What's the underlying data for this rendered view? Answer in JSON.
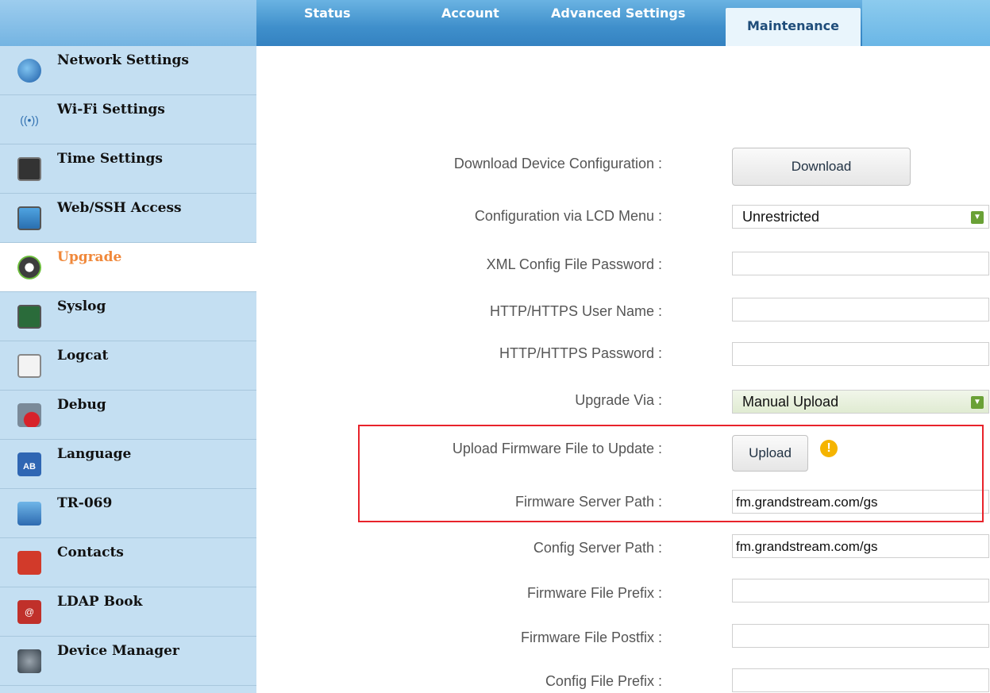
{
  "tabs": [
    {
      "label": "Status"
    },
    {
      "label": "Account"
    },
    {
      "label": "Advanced Settings"
    },
    {
      "label": "Maintenance"
    }
  ],
  "sidebar": {
    "items": [
      {
        "label": "Network Settings",
        "icon": "network-globe-icon"
      },
      {
        "label": "Wi-Fi Settings",
        "icon": "wifi-icon"
      },
      {
        "label": "Time Settings",
        "icon": "clock-icon"
      },
      {
        "label": "Web/SSH Access",
        "icon": "monitor-icon"
      },
      {
        "label": "Upgrade",
        "icon": "upgrade-icon"
      },
      {
        "label": "Syslog",
        "icon": "syslog-icon"
      },
      {
        "label": "Logcat",
        "icon": "magnifier-icon"
      },
      {
        "label": "Debug",
        "icon": "bug-icon"
      },
      {
        "label": "Language",
        "icon": "language-icon"
      },
      {
        "label": "TR-069",
        "icon": "tr069-icon"
      },
      {
        "label": "Contacts",
        "icon": "phone-icon"
      },
      {
        "label": "LDAP Book",
        "icon": "ldap-icon"
      },
      {
        "label": "Device Manager",
        "icon": "tools-icon"
      }
    ],
    "active": "Upgrade"
  },
  "form": {
    "download_config_label": "Download Device Configuration :",
    "download_button": "Download",
    "lcd_menu_label": "Configuration via LCD Menu :",
    "lcd_menu_value": "Unrestricted",
    "xml_password_label": "XML Config File Password :",
    "xml_password_value": "",
    "http_user_label": "HTTP/HTTPS User Name :",
    "http_user_value": "",
    "http_password_label": "HTTP/HTTPS Password :",
    "http_password_value": "",
    "upgrade_via_label": "Upgrade Via :",
    "upgrade_via_value": "Manual Upload",
    "upload_firmware_label": "Upload Firmware File to Update :",
    "upload_button": "Upload",
    "warning_glyph": "!",
    "firmware_server_label": "Firmware Server Path :",
    "firmware_server_value": "fm.grandstream.com/gs",
    "config_server_label": "Config Server Path :",
    "config_server_value": "fm.grandstream.com/gs",
    "fw_prefix_label": "Firmware File Prefix :",
    "fw_prefix_value": "",
    "fw_postfix_label": "Firmware File Postfix :",
    "fw_postfix_value": "",
    "config_prefix_label": "Config File Prefix :",
    "config_prefix_value": ""
  },
  "colors": {
    "active_nav": "#f0883a",
    "highlight_box": "#e8232b",
    "tab_bar": "#3f8fcb"
  }
}
